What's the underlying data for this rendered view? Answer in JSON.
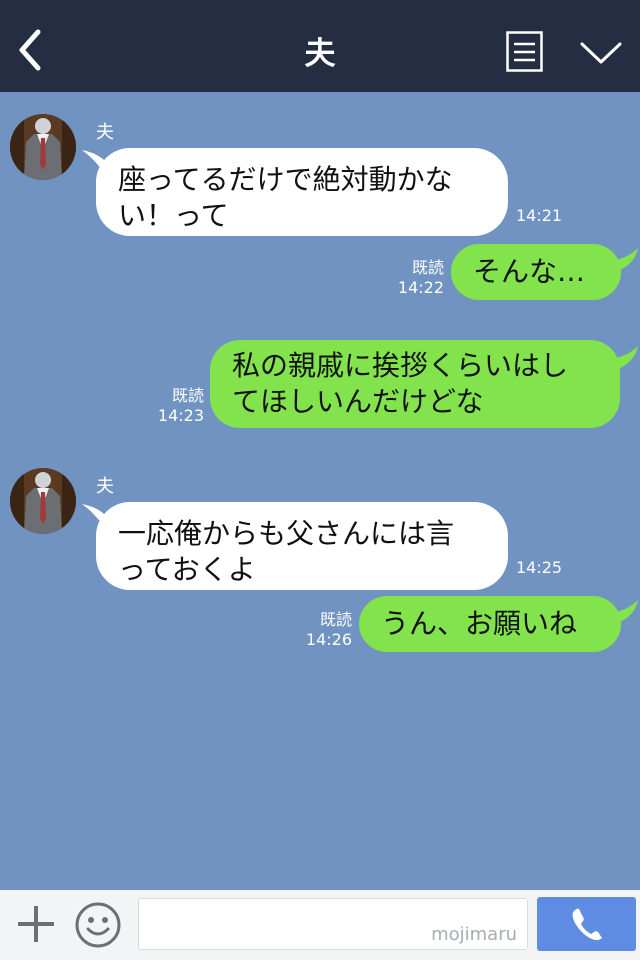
{
  "header": {
    "back_icon": "chevron-left-icon",
    "title": "夫",
    "menu_icon": "list-icon",
    "collapse_icon": "chevron-down-icon",
    "background": "#242d42"
  },
  "chat": {
    "background": "#7193c2",
    "messages": [
      {
        "side": "in",
        "sender": "夫",
        "lines": [
          "座ってるだけで絶対動かな",
          "い！って"
        ],
        "time": "14:21"
      },
      {
        "side": "out",
        "text": "そんな…",
        "read": "既読",
        "time": "14:22"
      },
      {
        "side": "out",
        "lines": [
          "私の親戚に挨拶くらいはし",
          "てほしいんだけどな"
        ],
        "read": "既読",
        "time": "14:23"
      },
      {
        "side": "in",
        "sender": "夫",
        "lines": [
          "一応俺からも父さんには言",
          "っておくよ"
        ],
        "time": "14:25"
      },
      {
        "side": "out",
        "text": "うん、お願いね",
        "read": "既読",
        "time": "14:26"
      }
    ]
  },
  "footer": {
    "plus_icon": "plus-icon",
    "emoji_icon": "smiley-icon",
    "input_value": "",
    "input_placeholder": "",
    "watermark": "mojimaru",
    "call_icon": "phone-icon",
    "call_color": "#5f8ce3"
  },
  "colors": {
    "incoming_bubble": "#ffffff",
    "outgoing_bubble": "#82e34c"
  }
}
